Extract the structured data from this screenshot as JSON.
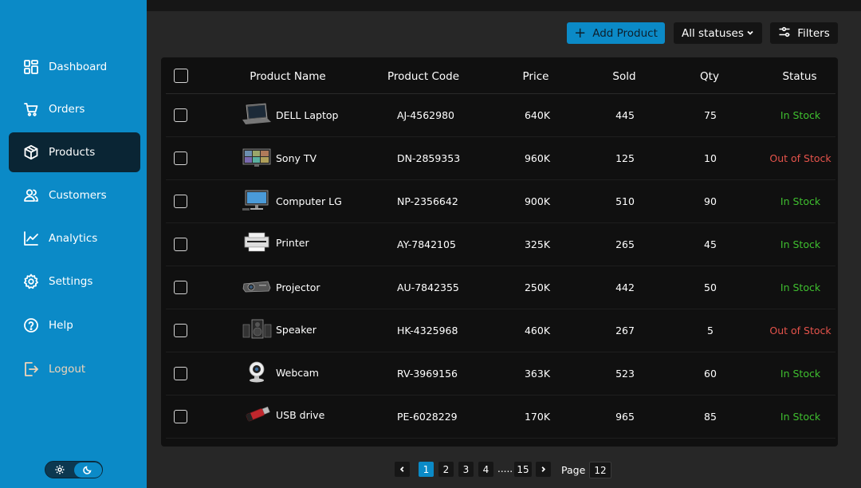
{
  "sidebar": {
    "items": [
      {
        "label": "Dashboard",
        "icon": "dashboard-icon"
      },
      {
        "label": "Orders",
        "icon": "cart-icon"
      },
      {
        "label": "Products",
        "icon": "box-icon",
        "active": true
      },
      {
        "label": "Customers",
        "icon": "users-icon"
      },
      {
        "label": "Analytics",
        "icon": "chart-icon"
      },
      {
        "label": "Settings",
        "icon": "gear-icon"
      },
      {
        "label": "Help",
        "icon": "help-icon"
      },
      {
        "label": "Logout",
        "icon": "logout-icon"
      }
    ],
    "theme": {
      "selected": "dark"
    }
  },
  "toolbar": {
    "add_label": "Add Product",
    "status_select": "All statuses",
    "filters_label": "Filters"
  },
  "table": {
    "headers": [
      "Product Name",
      "Product Code",
      "Price",
      "Sold",
      "Qty",
      "Status"
    ],
    "rows": [
      {
        "name": "DELL Laptop",
        "code": "AJ-4562980",
        "price": "640K",
        "sold": "445",
        "qty": "75",
        "status": "In Stock",
        "image": "laptop-image"
      },
      {
        "name": "Sony TV",
        "code": "DN-2859353",
        "price": "960K",
        "sold": "125",
        "qty": "10",
        "status": "Out of Stock",
        "image": "tv-image"
      },
      {
        "name": "Computer LG",
        "code": "NP-2356642",
        "price": "900K",
        "sold": "510",
        "qty": "90",
        "status": "In Stock",
        "image": "monitor-image"
      },
      {
        "name": "Printer",
        "code": "AY-7842105",
        "price": "325K",
        "sold": "265",
        "qty": "45",
        "status": "In Stock",
        "image": "printer-image"
      },
      {
        "name": "Projector",
        "code": "AU-7842355",
        "price": "250K",
        "sold": "442",
        "qty": "50",
        "status": "In Stock",
        "image": "projector-image"
      },
      {
        "name": "Speaker",
        "code": "HK-4325968",
        "price": "460K",
        "sold": "267",
        "qty": "5",
        "status": "Out of Stock",
        "image": "speaker-image"
      },
      {
        "name": "Webcam",
        "code": "RV-3969156",
        "price": "363K",
        "sold": "523",
        "qty": "60",
        "status": "In Stock",
        "image": "webcam-image"
      },
      {
        "name": "USB drive",
        "code": "PE-6028229",
        "price": "170K",
        "sold": "965",
        "qty": "85",
        "status": "In Stock",
        "image": "usb-image"
      }
    ]
  },
  "pagination": {
    "pages": [
      "1",
      "2",
      "3",
      "4"
    ],
    "ellipsis": ".....",
    "last": "15",
    "current": "1",
    "page_label": "Page",
    "page_input": "12"
  },
  "colors": {
    "sidebar": "#0b8ac7",
    "active_nav": "#0a2534",
    "in_stock": "#3fbf2f",
    "out_of_stock": "#e5534b",
    "accent": "#0b8ac7"
  }
}
